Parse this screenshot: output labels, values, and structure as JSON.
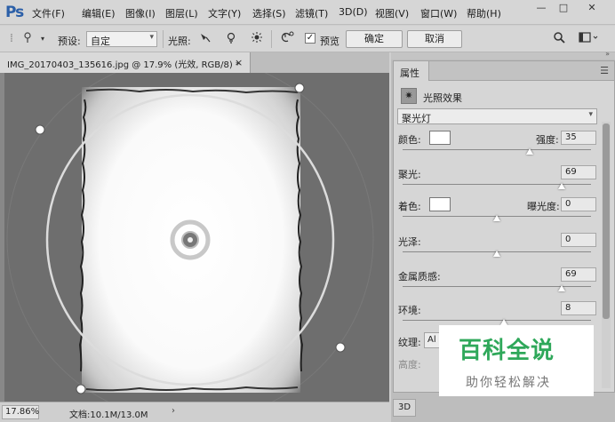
{
  "app": {
    "logo": "Ps"
  },
  "menu": [
    "文件(F)",
    "编辑(E)",
    "图像(I)",
    "图层(L)",
    "文字(Y)",
    "选择(S)",
    "滤镜(T)",
    "3D(D)",
    "视图(V)",
    "窗口(W)",
    "帮助(H)"
  ],
  "window_controls": {
    "minimize": "—",
    "restore": "□",
    "close": "✕"
  },
  "options": {
    "preset_label": "预设:",
    "preset_value": "自定",
    "light_label": "光照:",
    "preview_label": "预览",
    "preview_checked": true,
    "ok_label": "确定",
    "cancel_label": "取消"
  },
  "document": {
    "tab_title": "IMG_20170403_135616.jpg @ 17.9% (光效, RGB/8) *",
    "close_glyph": "×",
    "zoom": "17.86%",
    "doc_size": "文档:10.1M/13.0M",
    "status_arrow": "›"
  },
  "properties": {
    "tab_label": "属性",
    "effect_title": "光照效果",
    "light_type": "聚光灯",
    "color_label": "颜色:",
    "intensity_label": "强度:",
    "intensity_value": "35",
    "intensity_level": 35,
    "hotspot_label": "聚光:",
    "hotspot_value": "69",
    "hotspot_level": 69,
    "colorize_label": "着色:",
    "exposure_label": "曝光度:",
    "exposure_value": "0",
    "exposure_level": 0,
    "gloss_label": "光泽:",
    "gloss_value": "0",
    "gloss_level": 0,
    "metallic_label": "金属质感:",
    "metallic_value": "69",
    "metallic_level": 69,
    "ambience_label": "环境:",
    "ambience_value": "8",
    "ambience_level": 8,
    "texture_label": "纹理:",
    "texture_value": "Al",
    "height_label": "高度:",
    "light_color": "#ffffff",
    "colorize_color": "#ffffff"
  },
  "dock": {
    "tab_3d": "3D"
  },
  "watermark": {
    "logo": "百科全说",
    "sub": "助你轻松解决",
    "color": "#2fa85a"
  }
}
